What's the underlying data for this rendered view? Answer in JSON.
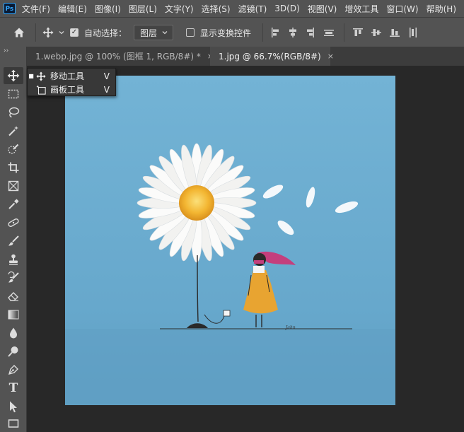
{
  "app": {
    "logo_text": "Ps"
  },
  "menu": [
    "文件(F)",
    "编辑(E)",
    "图像(I)",
    "图层(L)",
    "文字(Y)",
    "选择(S)",
    "滤镜(T)",
    "3D(D)",
    "视图(V)",
    "增效工具",
    "窗口(W)",
    "帮助(H)"
  ],
  "options_bar": {
    "home_icon": "home-icon",
    "tool_icon": "move-icon",
    "auto_select_label": "自动选择：",
    "auto_select_checked": true,
    "auto_select_target": "图层",
    "show_transform_label": "显示变换控件",
    "show_transform_checked": false
  },
  "tabs": [
    {
      "title": "1.webp.jpg @ 100% (图框 1, RGB/8#) *",
      "close": "×",
      "active": false
    },
    {
      "title": "1.jpg @ 66.7%(RGB/8#)",
      "close": "×",
      "active": true
    }
  ],
  "toolbar": {
    "collapse_glyph": "››",
    "tools": [
      "move-tool",
      "marquee-tool",
      "lasso-tool",
      "magic-wand-tool",
      "quick-selection-tool",
      "crop-tool",
      "frame-tool",
      "eyedropper-tool",
      "healing-brush-tool",
      "brush-tool",
      "clone-stamp-tool",
      "history-brush-tool",
      "eraser-tool",
      "gradient-tool",
      "blur-tool",
      "dodge-tool",
      "pen-tool",
      "type-tool",
      "path-selection-tool",
      "rectangle-tool"
    ],
    "type_tool_glyph": "T"
  },
  "flyout": {
    "items": [
      {
        "label": "移动工具",
        "shortcut": "V",
        "icon": "move-icon",
        "selected": true
      },
      {
        "label": "画板工具",
        "shortcut": "V",
        "icon": "artboard-icon",
        "selected": false
      }
    ]
  },
  "canvas": {
    "artwork": "daisy-and-girl-illustration",
    "background_color": "#6aa9cc",
    "signature": "Jahn"
  }
}
